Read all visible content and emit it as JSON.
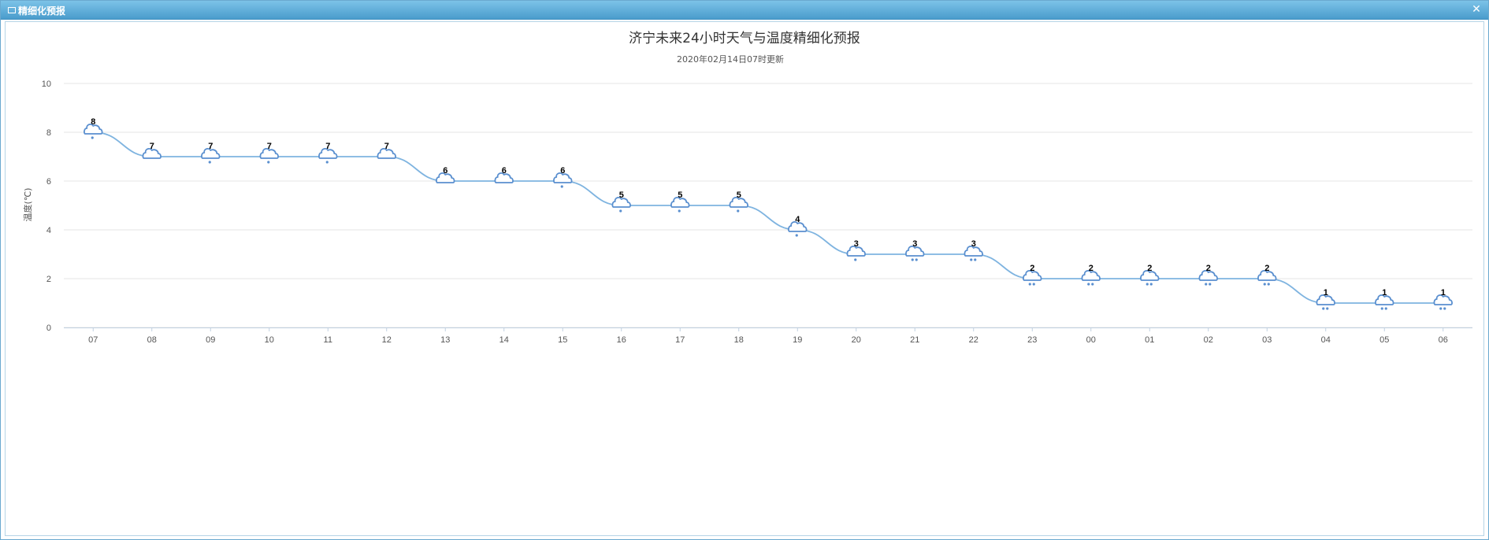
{
  "window": {
    "title": "精细化预报",
    "close_glyph": "✕",
    "icon": "window-icon"
  },
  "chart_data": {
    "type": "line",
    "title": "济宁未来24小时天气与温度精细化预报",
    "subtitle": "2020年02月14日07时更新",
    "ylabel": "温度(℃)",
    "xlabel": "",
    "ylim": [
      0,
      10
    ],
    "yticks": [
      "0",
      "2",
      "4",
      "6",
      "8",
      "10"
    ],
    "categories": [
      "07",
      "08",
      "09",
      "10",
      "11",
      "12",
      "13",
      "14",
      "15",
      "16",
      "17",
      "18",
      "19",
      "20",
      "21",
      "22",
      "23",
      "00",
      "01",
      "02",
      "03",
      "04",
      "05",
      "06"
    ],
    "values": [
      8,
      7,
      7,
      7,
      7,
      7,
      6,
      6,
      6,
      5,
      5,
      5,
      4,
      3,
      3,
      3,
      2,
      2,
      2,
      2,
      2,
      1,
      1,
      1
    ],
    "markers": [
      "light-snow-icon",
      "cloudy-icon",
      "light-snow-icon",
      "light-snow-icon",
      "light-snow-icon",
      "cloudy-icon",
      "cloudy-icon",
      "cloudy-icon",
      "light-snow-icon",
      "light-snow-icon",
      "light-snow-icon",
      "light-snow-icon",
      "light-snow-icon",
      "light-snow-icon",
      "moderate-snow-icon",
      "moderate-snow-icon",
      "moderate-snow-icon",
      "moderate-snow-icon",
      "moderate-snow-icon",
      "moderate-snow-icon",
      "moderate-snow-icon",
      "moderate-snow-icon",
      "moderate-snow-icon",
      "moderate-snow-icon"
    ],
    "grid": true,
    "legend": "none",
    "line_color": "#7fb4e0",
    "icon_color": "#5a8fcf"
  }
}
